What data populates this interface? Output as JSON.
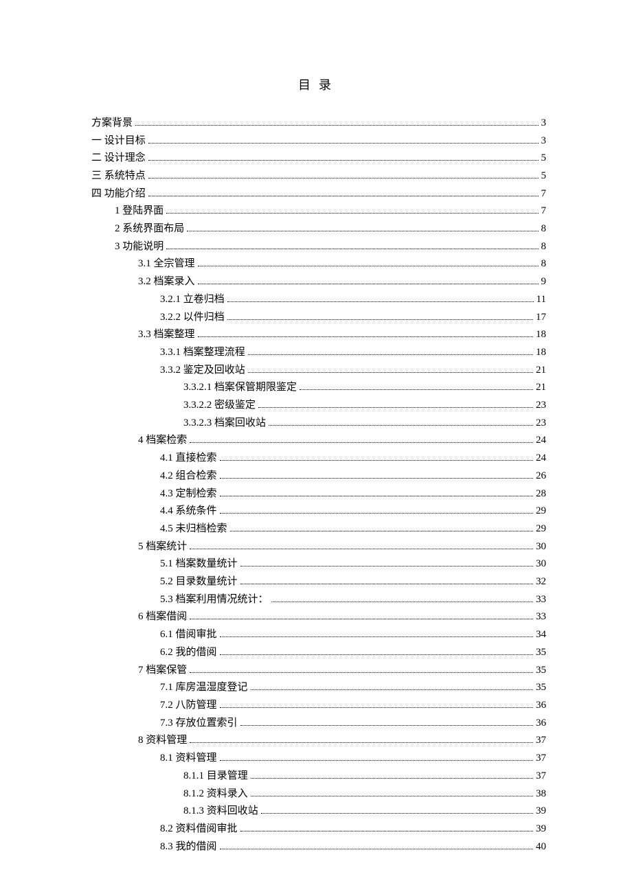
{
  "title": "目录",
  "toc": [
    {
      "label": "方案背景",
      "page": "3",
      "indent": 0
    },
    {
      "label": "一  设计目标",
      "page": "3",
      "indent": 0
    },
    {
      "label": "二  设计理念",
      "page": "5",
      "indent": 0
    },
    {
      "label": "三  系统特点",
      "page": "5",
      "indent": 0
    },
    {
      "label": "四  功能介绍",
      "page": "7",
      "indent": 0
    },
    {
      "label": "1 登陆界面",
      "page": "7",
      "indent": 1
    },
    {
      "label": "2 系统界面布局",
      "page": "8",
      "indent": 1
    },
    {
      "label": "3 功能说明",
      "page": "8",
      "indent": 1
    },
    {
      "label": "3.1 全宗管理",
      "page": "8",
      "indent": 2
    },
    {
      "label": "3.2 档案录入",
      "page": "9",
      "indent": 2
    },
    {
      "label": "3.2.1 立卷归档",
      "page": "11",
      "indent": 3
    },
    {
      "label": "3.2.2 以件归档",
      "page": "17",
      "indent": 3
    },
    {
      "label": "3.3 档案整理",
      "page": "18",
      "indent": 2
    },
    {
      "label": "3.3.1 档案整理流程",
      "page": "18",
      "indent": 3
    },
    {
      "label": "3.3.2 鉴定及回收站",
      "page": "21",
      "indent": 3
    },
    {
      "label": "3.3.2.1 档案保管期限鉴定",
      "page": "21",
      "indent": 4
    },
    {
      "label": "3.3.2.2 密级鉴定",
      "page": "23",
      "indent": 4
    },
    {
      "label": "3.3.2.3 档案回收站",
      "page": "23",
      "indent": 4
    },
    {
      "label": "4 档案检索",
      "page": "24",
      "indent": 2
    },
    {
      "label": "4.1 直接检索",
      "page": "24",
      "indent": 3
    },
    {
      "label": "4.2 组合检索",
      "page": "26",
      "indent": 3
    },
    {
      "label": "4.3 定制检索",
      "page": "28",
      "indent": 3
    },
    {
      "label": "4.4 系统条件",
      "page": "29",
      "indent": 3
    },
    {
      "label": "4.5 未归档检索",
      "page": "29",
      "indent": 3
    },
    {
      "label": "5 档案统计",
      "page": "30",
      "indent": 2
    },
    {
      "label": "5.1  档案数量统计",
      "page": "30",
      "indent": 3
    },
    {
      "label": "5.2 目录数量统计",
      "page": "32",
      "indent": 3
    },
    {
      "label": "5.3 档案利用情况统计：",
      "page": "33",
      "indent": 3
    },
    {
      "label": "6 档案借阅",
      "page": "33",
      "indent": 2
    },
    {
      "label": "6.1 借阅审批",
      "page": "34",
      "indent": 3
    },
    {
      "label": "6.2 我的借阅",
      "page": "35",
      "indent": 3
    },
    {
      "label": "7 档案保管",
      "page": "35",
      "indent": 2
    },
    {
      "label": "7.1 库房温湿度登记",
      "page": "35",
      "indent": 3
    },
    {
      "label": "7.2 八防管理",
      "page": "36",
      "indent": 3
    },
    {
      "label": "7.3 存放位置索引",
      "page": "36",
      "indent": 3
    },
    {
      "label": "8 资料管理",
      "page": "37",
      "indent": 2
    },
    {
      "label": "8.1 资料管理",
      "page": "37",
      "indent": 3
    },
    {
      "label": "8.1.1 目录管理",
      "page": "37",
      "indent": 4
    },
    {
      "label": "8.1.2 资料录入",
      "page": "38",
      "indent": 4
    },
    {
      "label": "8.1.3 资料回收站",
      "page": "39",
      "indent": 4
    },
    {
      "label": "8.2 资料借阅审批",
      "page": "39",
      "indent": 3
    },
    {
      "label": "8.3 我的借阅",
      "page": "40",
      "indent": 3
    }
  ]
}
